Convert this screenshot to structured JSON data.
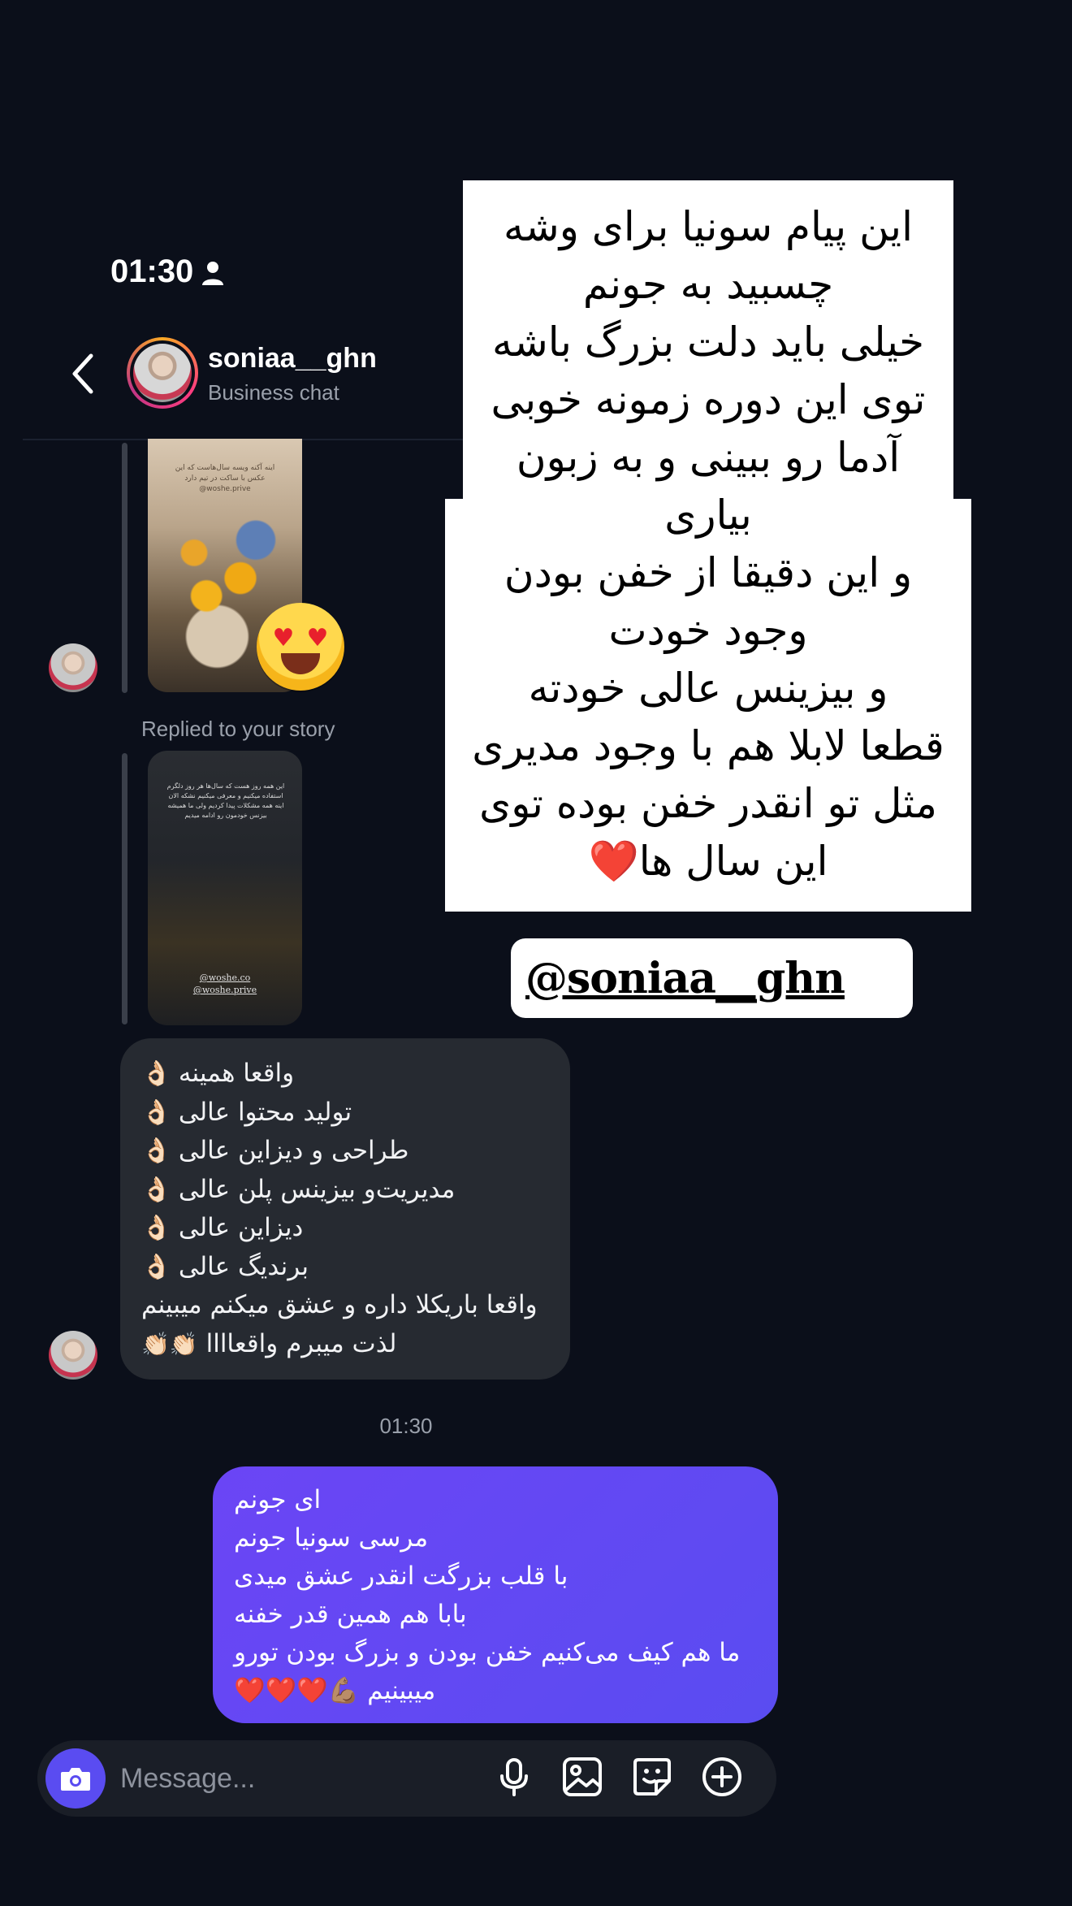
{
  "status_bar": {
    "time": "01:30"
  },
  "header": {
    "username": "soniaa__ghn",
    "subtitle": "Business chat"
  },
  "thread": {
    "story1_text": "اینه آکنه ویسه سال‌هاست که این عکس با ساکت در تیم دارد @woshe.prive",
    "reaction_emoji": "😍",
    "replied_label": "Replied to your story",
    "story2_text": "این همه روز هست که سال‌ها هر روز دلگرم استفاده میکنیم و معرفی میکنیم نشکه الان اینه همه مشکلات پیدا کردیم ولی ما همیشه بیزنس خودمون رو ادامه میدیم",
    "story2_handles": [
      "@woshe.co",
      "@woshe.prive"
    ],
    "incoming_lines": [
      {
        "emoji": "👌🏻",
        "text": "واقعا همینه"
      },
      {
        "emoji": "👌🏻",
        "text": "تولید محتوا عالی"
      },
      {
        "emoji": "👌🏻",
        "text": "طراحی و دیزاین عالی"
      },
      {
        "emoji": "👌🏻",
        "text": "مدیریت‌و بیزینس پلن عالی"
      },
      {
        "emoji": "👌🏻",
        "text": "دیزاین عالی"
      },
      {
        "emoji": "👌🏻",
        "text": "برندیگ عالی"
      },
      {
        "emoji": "",
        "text": "واقعا باریکلا داره و عشق میکنم میبینم"
      },
      {
        "emoji": "👏🏻👏🏻",
        "text": "لذت میبرم واقعاااا"
      }
    ],
    "time_separator": "01:30",
    "outgoing_lines": [
      "ای جونم",
      "مرسی سونیا جونم",
      "با قلب بزرگت انقدر عشق میدی",
      "بابا هم همین قدر خفنه",
      "ما هم کیف می‌کنیم خفن بودن و بزرگ بودن تورو",
      "❤️❤️❤️💪🏽 میبینیم"
    ]
  },
  "composer": {
    "placeholder": "Message..."
  },
  "overlay": {
    "lines": [
      "این پیام سونیا برای وشه",
      "چسبید به جونم",
      "خیلی باید دلت بزرگ باشه",
      "توی این دوره زمونه خوبی",
      "آدما رو ببینی و به زبون",
      "بیاری",
      "و این دقیقا از خفن بودن",
      "وجود خودت",
      "و بیزینس عالی خودته",
      "قطعا لابلا هم با وجود مدیری",
      "مثل تو انقدر خفن بوده توی",
      "این سال ها❤️"
    ],
    "mention": "@soniaa__ghn",
    "mention_emoji": "😘"
  },
  "colors": {
    "background": "#0b0f1a",
    "incoming_bubble": "#262a31",
    "outgoing_bubble": "#5a4cf1",
    "overlay_card": "#ffffff"
  }
}
